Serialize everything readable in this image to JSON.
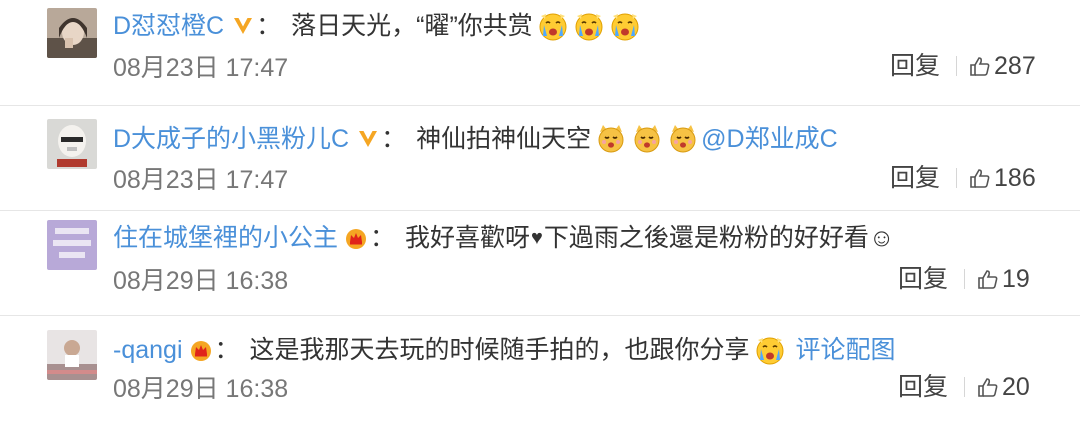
{
  "comments": [
    {
      "username": "D怼怼橙C",
      "text": "落日天光，“曜”你共赏",
      "timestamp": "08月23日 17:47",
      "reply_label": "回复",
      "likes": "287",
      "badge": "v-icon",
      "emojis": [
        "crying-face-icon",
        "crying-face-icon",
        "crying-face-icon"
      ]
    },
    {
      "username": "D大成子的小黑粉儿C",
      "text": "神仙拍神仙天空",
      "mention": "@D郑业成C",
      "timestamp": "08月23日 17:47",
      "reply_label": "回复",
      "likes": "186",
      "badge": "v-icon",
      "emojis": [
        "cat-face-icon",
        "cat-face-icon",
        "cat-face-icon"
      ]
    },
    {
      "username": "住在城堡裡的小公主",
      "text_before": "我好喜歡呀",
      "text_after": "下過雨之後還是粉粉的好好看☺",
      "heart": "♥",
      "timestamp": "08月29日 16:38",
      "reply_label": "回复",
      "likes": "19",
      "badge": "crown-icon"
    },
    {
      "username": "-qangi",
      "text": "这是我那天去玩的时候随手拍的，也跟你分享",
      "pic_link": "评论配图",
      "timestamp": "08月29日 16:38",
      "reply_label": "回复",
      "likes": "20",
      "badge": "crown-icon",
      "emojis": [
        "crying-face-icon"
      ]
    }
  ],
  "colors": {
    "link_blue": "#4a90d9",
    "vip_orange": "#f5a623",
    "text_dark": "#333333",
    "meta_gray": "#777777"
  }
}
